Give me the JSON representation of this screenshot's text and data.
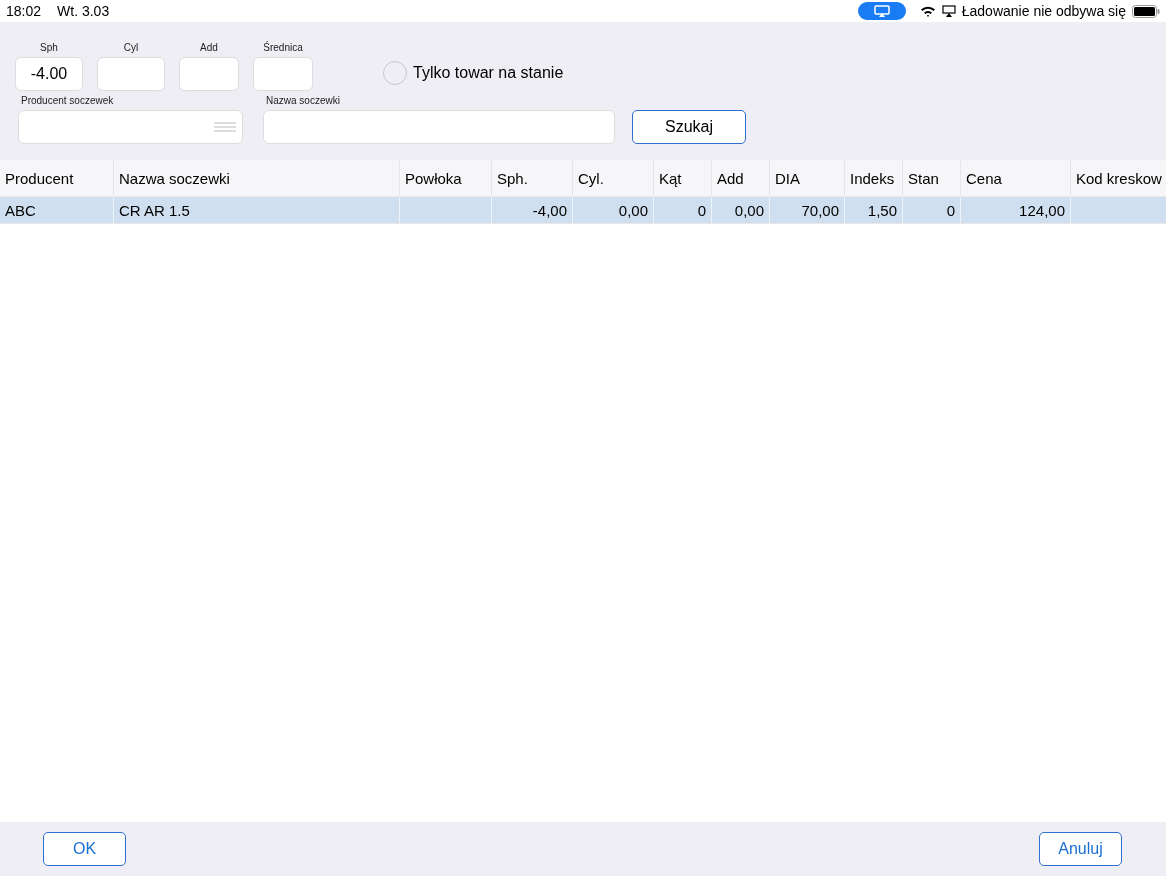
{
  "status_bar": {
    "time": "18:02",
    "date": "Wt. 3.03",
    "battery_text": "Ładowanie nie odbywa się"
  },
  "filters": {
    "small_fields": [
      {
        "label": "Sph",
        "value": "-4.00"
      },
      {
        "label": "Cyl"
      },
      {
        "label": "Add"
      },
      {
        "label": "Średnica"
      }
    ],
    "stock_only": {
      "label": "Tylko towar na stanie",
      "checked": false
    },
    "producer": {
      "label": "Producent soczewek"
    },
    "name": {
      "label": "Nazwa soczewki"
    },
    "search_button": "Szukaj"
  },
  "table": {
    "columns": [
      "Producent",
      "Nazwa soczewki",
      "Powłoka",
      "Sph.",
      "Cyl.",
      "Kąt",
      "Add",
      "DIA",
      "Indeks",
      "Stan",
      "Cena",
      "Kod kreskow"
    ],
    "rows": [
      {
        "selected": true,
        "cells": [
          "ABC",
          "CR AR 1.5",
          null,
          "-4,00",
          "0,00",
          "0",
          "0,00",
          "70,00",
          "1,50",
          "0",
          "124,00",
          null
        ]
      }
    ]
  },
  "buttons": {
    "ok": "OK",
    "cancel": "Anuluj"
  }
}
